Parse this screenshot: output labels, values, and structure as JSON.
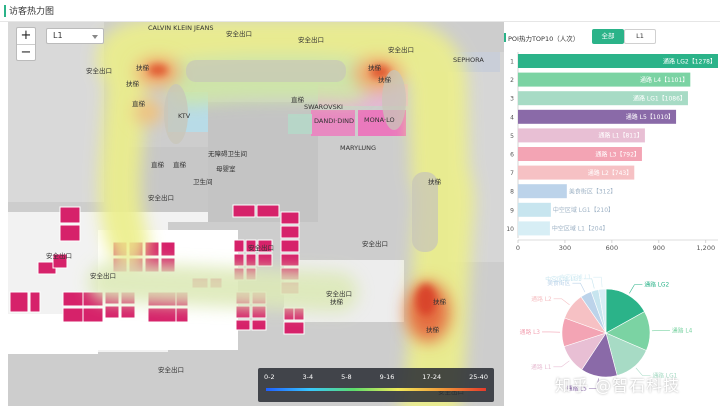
{
  "header": {
    "title": "访客热力图"
  },
  "map": {
    "zoom_in": "+",
    "zoom_out": "−",
    "floor_select": "L1",
    "legend_ranges": [
      "0-2",
      "3-4",
      "5-8",
      "9-16",
      "17-24",
      "25-40"
    ],
    "labels": {
      "anquan": "安全出口",
      "futi": "扶梯",
      "zhiti": "直梯",
      "sephora": "SEPHORA",
      "marylung": "MARYLUNG",
      "dandi": "DANDI·DIND",
      "mona": "MONA·LO",
      "swarovski": "SWAROVSKI",
      "ktv": "KTV",
      "cesuo": "卫生间",
      "wuzhang": "无障碍卫生间",
      "muying": "母婴室",
      "calvin": "CALVIN KLEIN JEANS"
    }
  },
  "panel": {
    "title": "POI热力TOP10（人次）",
    "btn_all": "全部",
    "btn_l1": "L1"
  },
  "watermark": "知乎 @智石科技",
  "chart_data": [
    {
      "type": "bar",
      "orientation": "horizontal",
      "categories": [
        "1",
        "2",
        "3",
        "4",
        "5",
        "6",
        "7",
        "8",
        "9",
        "10"
      ],
      "labels": [
        "通路 LG2【1278】",
        "通路 L4【1101】",
        "通路 LG1【1086】",
        "通路 L5【1010】",
        "通路 L1【811】",
        "通路 L3【792】",
        "通路 L2【743】",
        "美食街区【312】",
        "中空区域 LG1【210】",
        "中空区域 L1【204】"
      ],
      "values": [
        1278,
        1101,
        1086,
        1010,
        811,
        792,
        743,
        312,
        210,
        204
      ],
      "colors": [
        "#2bb389",
        "#7bd3a3",
        "#a7dbc5",
        "#8a6aa8",
        "#e8bfd4",
        "#f3a4b4",
        "#f6c1c4",
        "#bcd3ea",
        "#c7e5ef",
        "#d7eef5"
      ],
      "xticks": [
        0,
        300,
        600,
        900,
        1200
      ],
      "xtick_labels": [
        "0",
        "300",
        "600",
        "900",
        "1,200"
      ],
      "xlim": [
        0,
        1278
      ]
    },
    {
      "type": "pie",
      "categories": [
        "通路 LG2",
        "通路 L4",
        "通路 LG1",
        "通路 L5",
        "通路 L1",
        "通路 L3",
        "通路 L2",
        "美食街区",
        "中空区域 LG1",
        "中空区域 L1"
      ],
      "values": [
        1278,
        1101,
        1086,
        1010,
        811,
        792,
        743,
        312,
        210,
        204
      ],
      "colors": [
        "#2bb389",
        "#7bd3a3",
        "#a7dbc5",
        "#8a6aa8",
        "#e8bfd4",
        "#f3a4b4",
        "#f6c1c4",
        "#bcd3ea",
        "#c7e5ef",
        "#d7eef5"
      ],
      "visible_labels": [
        "通路 LG2",
        "通路 L4",
        "通路 LG1",
        "通路 L5",
        "通路 L1",
        "通路 L3",
        "通路 L2",
        "美食街区",
        "中空区域 LG1",
        "中空区域 L1"
      ]
    }
  ]
}
